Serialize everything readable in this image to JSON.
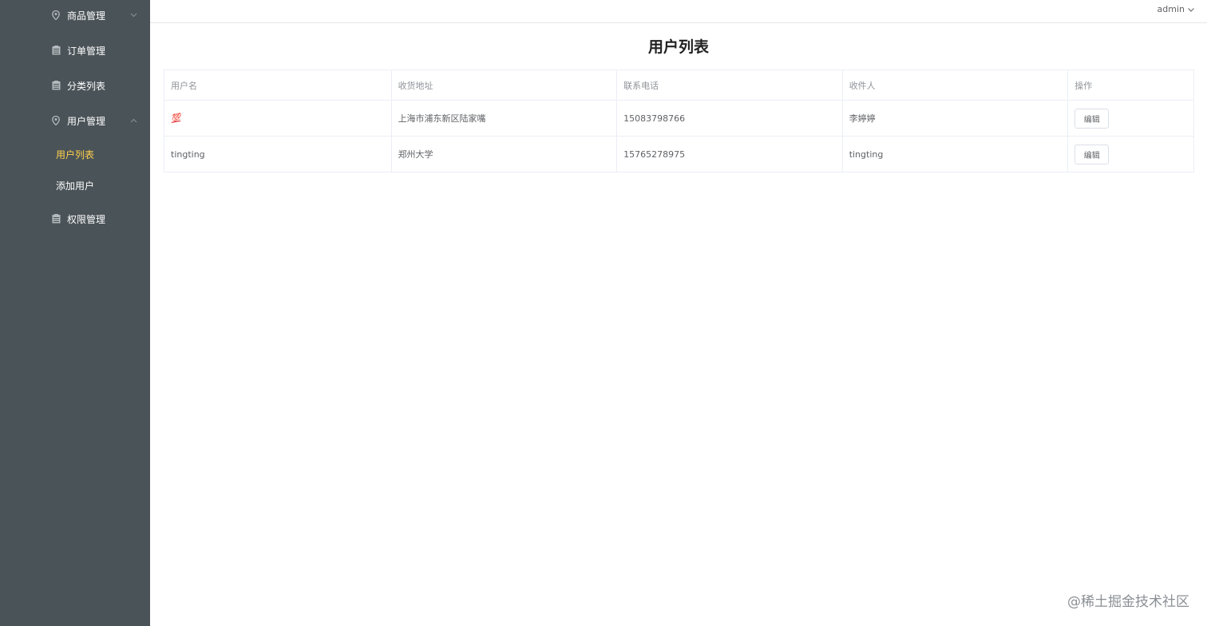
{
  "sidebar": {
    "menus": [
      {
        "label": "商品管理",
        "icon": "location-icon",
        "arrow": "down"
      },
      {
        "label": "订单管理",
        "icon": "document-icon"
      },
      {
        "label": "分类列表",
        "icon": "document-icon"
      },
      {
        "label": "用户管理",
        "icon": "location-icon",
        "arrow": "up"
      },
      {
        "label": "权限管理",
        "icon": "document-icon"
      }
    ],
    "submenu": [
      {
        "label": "用户列表",
        "active": true
      },
      {
        "label": "添加用户",
        "active": false
      }
    ],
    "active_color": "#ffd04b",
    "bg_color": "#4a5358"
  },
  "header": {
    "user": "admin"
  },
  "main": {
    "title": "用户列表",
    "table": {
      "columns": [
        "用户名",
        "收货地址",
        "联系电话",
        "收件人",
        "操作"
      ],
      "rows": [
        {
          "username": "💯",
          "address": "上海市浦东新区陆家嘴",
          "phone": "15083798766",
          "receiver": "李婷婷",
          "action": "编辑"
        },
        {
          "username": "tingting",
          "address": "郑州大学",
          "phone": "15765278975",
          "receiver": "tingting",
          "action": "编辑"
        }
      ]
    }
  },
  "watermark": "@稀土掘金技术社区"
}
